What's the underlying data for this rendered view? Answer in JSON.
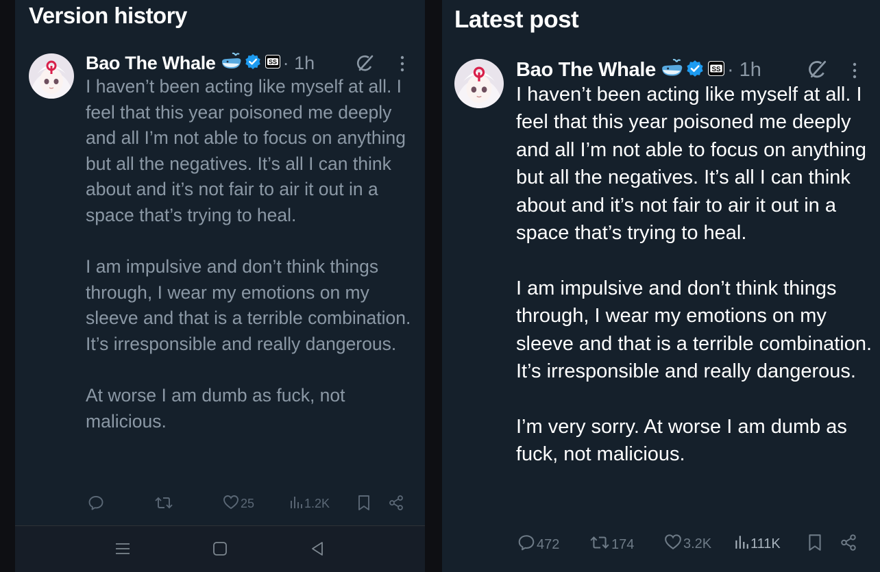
{
  "left": {
    "title": "Version history",
    "post": {
      "author": "Bao The Whale",
      "time": "· 1h",
      "text": "I haven’t been acting like myself at all. I feel that this year poisoned me deeply and all I’m not able to focus on anything but all the negatives. It’s all I can think about and it’s not fair to air it out in a space that’s trying to heal.\n\nI am impulsive and don’t think things through, I wear my emotions on my sleeve and that is a terrible combination. It’s irresponsible and really dangerous.\n\nAt worse I am dumb as fuck, not malicious."
    },
    "actions": {
      "likes": "25",
      "views": "1.2K"
    },
    "navbar": {
      "icons": [
        "menu-icon",
        "home-square-icon",
        "back-triangle-icon"
      ]
    }
  },
  "right": {
    "title": "Latest post",
    "post": {
      "author": "Bao The Whale",
      "time": "· 1h",
      "text": "I haven’t been acting like myself at all. I feel that this year poisoned me deeply and all I’m not able to focus on anything but all the negatives. It’s all I can think about and it’s not fair to air it out in a space that’s trying to heal.\n\nI am impulsive and don’t think things through, I wear my emotions on my sleeve and that is a terrible combination. It’s irresponsible and really dangerous.\n\nI’m very sorry. At worse I am dumb as fuck, not malicious."
    },
    "actions": {
      "replies": "472",
      "reposts": "174",
      "likes": "3.2K",
      "views": "111K"
    }
  },
  "colors": {
    "background": "#15202b",
    "verified_badge": "#1d9bf0",
    "muted_text": "#8b98a5",
    "primary_text": "#ffffff"
  },
  "icons": {
    "header": [
      "whale-emoji-icon",
      "verified-badge-icon",
      "affiliate-badge-icon",
      "grok-icon",
      "more-icon"
    ],
    "actions": [
      "reply-icon",
      "repost-icon",
      "like-icon",
      "views-icon",
      "bookmark-icon",
      "share-icon"
    ]
  }
}
